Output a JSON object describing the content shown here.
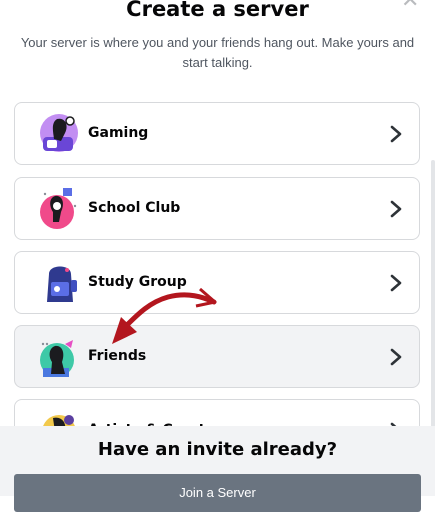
{
  "modal": {
    "title": "Create a server",
    "subtitle": "Your server is where you and your friends hang out. Make yours and start talking.",
    "close_icon": "close-icon"
  },
  "templates": [
    {
      "label": "Gaming",
      "icon": "gaming-icon"
    },
    {
      "label": "School Club",
      "icon": "school-club-icon"
    },
    {
      "label": "Study Group",
      "icon": "study-group-icon"
    },
    {
      "label": "Friends",
      "icon": "friends-icon"
    },
    {
      "label": "Artists & Creators",
      "icon": "artists-creators-icon"
    }
  ],
  "footer": {
    "heading": "Have an invite already?",
    "join_label": "Join a Server"
  },
  "colors": {
    "accent_arrow": "#b3161e",
    "button_bg": "#6a7480",
    "footer_bg": "#f2f3f5"
  }
}
